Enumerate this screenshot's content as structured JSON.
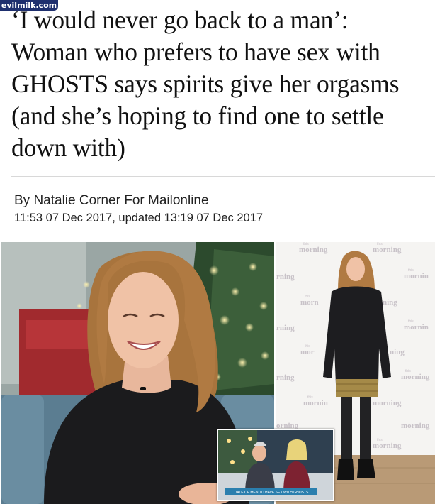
{
  "watermark": "evilmilk.com",
  "article": {
    "headline": "‘I would never go back to a man’: Woman who prefers to have sex with GHOSTS says spirits give her orgasms (and she’s hoping to find one to settle down with)",
    "byline": "By Natalie Corner For Mailonline",
    "dateline": "11:53 07 Dec 2017, updated 13:19 07 Dec 2017"
  },
  "images": {
    "backdrop_logo": "morning",
    "backdrop_logo_small": "this",
    "inset_caption": "DATE OF MEN TO HAVE SEX WITH GHOSTS"
  }
}
